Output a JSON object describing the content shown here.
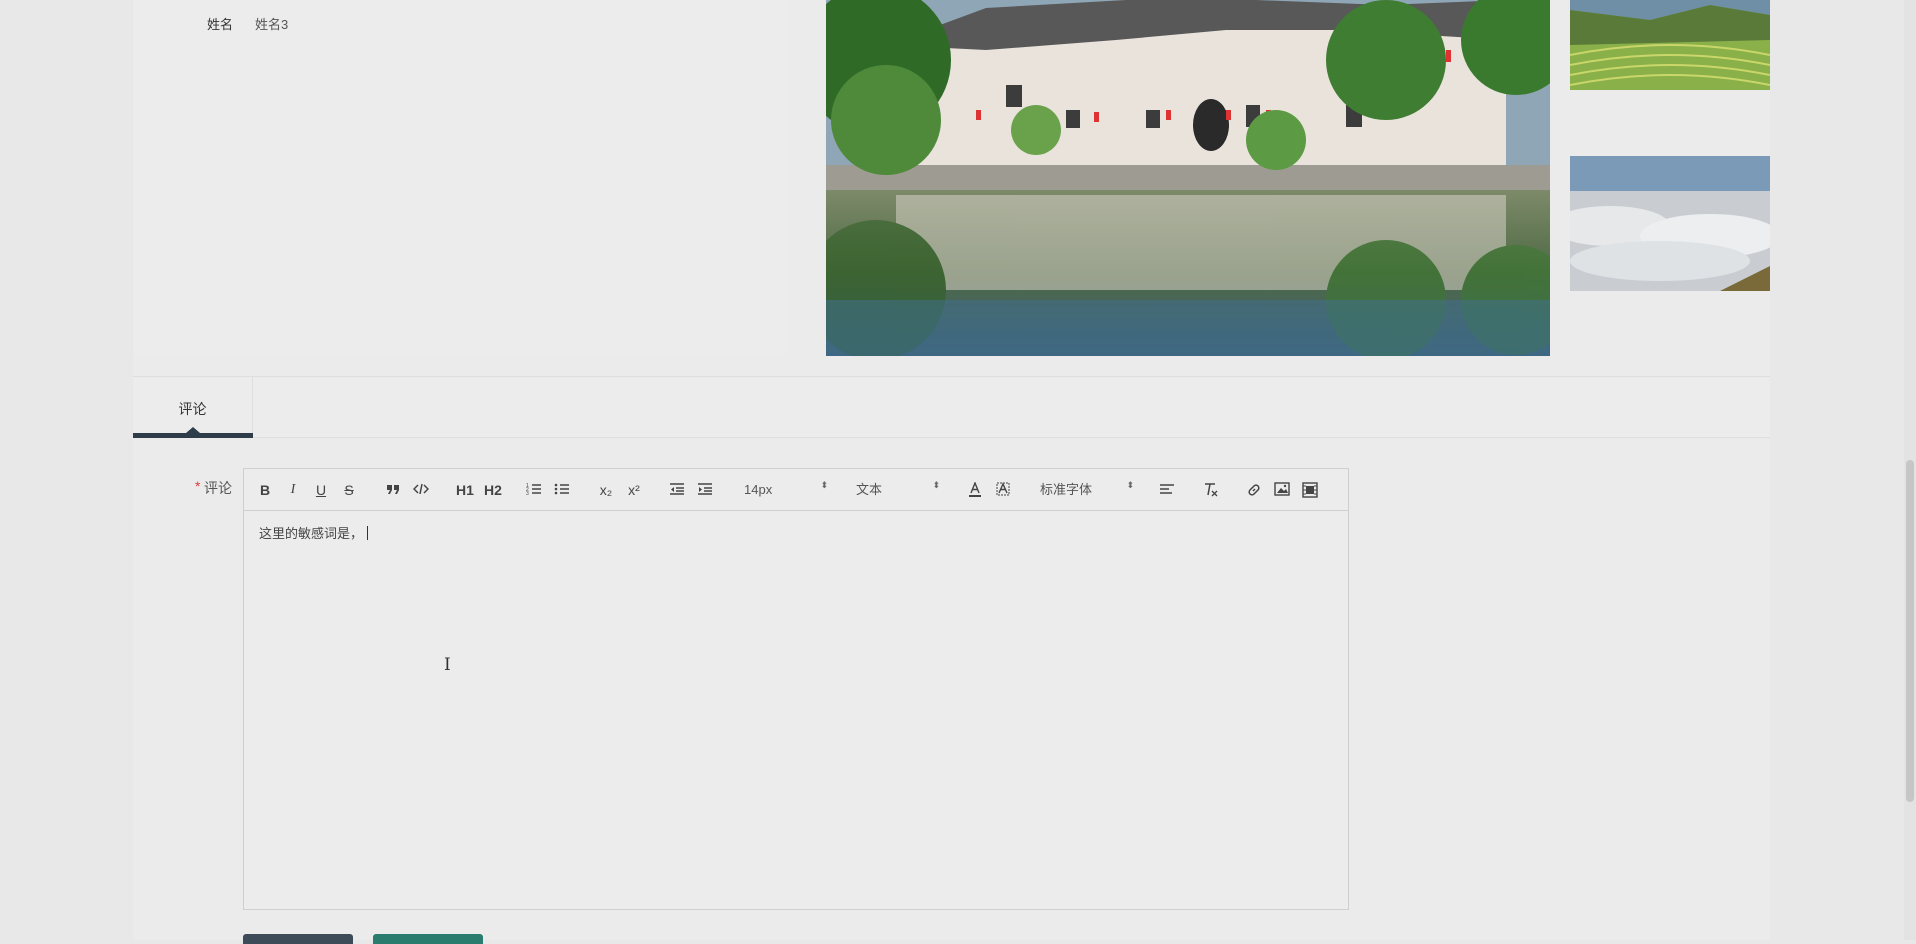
{
  "detail": {
    "name_label": "姓名",
    "name_value": "姓名3"
  },
  "images": {
    "main": "lake-village-image",
    "thumb1": "rice-terraces-image",
    "thumb2": "sea-of-clouds-image"
  },
  "tabs": [
    {
      "label": "评论"
    }
  ],
  "form": {
    "required_mark": "*",
    "comment_label": "评论",
    "comment_text": "这里的敏感词是，"
  },
  "toolbar": {
    "bold": "B",
    "italic": "I",
    "underline": "U",
    "strike": "S",
    "h1": "H1",
    "h2": "H2",
    "sub": "x₂",
    "sup": "x²",
    "size_value": "14px",
    "header_value": "文本",
    "font_value": "标准字体",
    "select_arrow": "⬍"
  },
  "colors": {
    "accent": "#2f3d4a",
    "required": "#e4393c",
    "secondary_button": "#2a7d6e"
  }
}
